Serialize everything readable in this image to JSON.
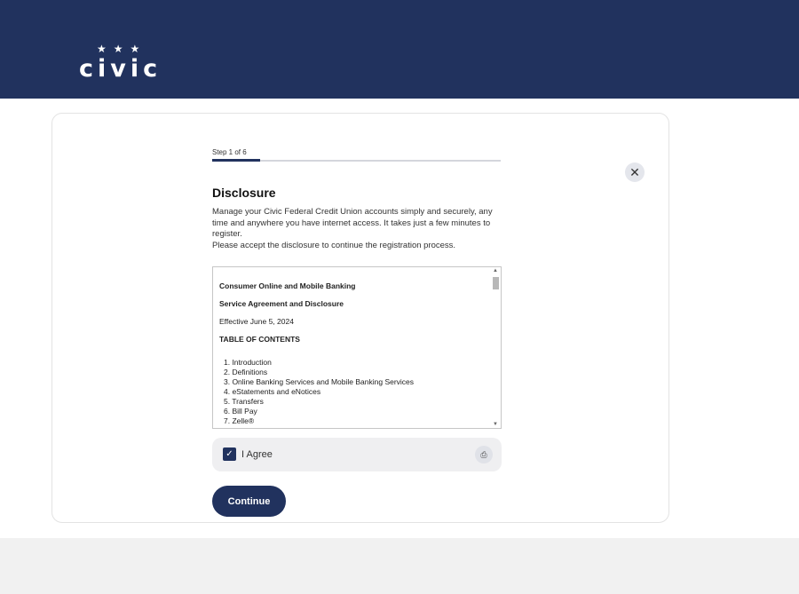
{
  "header": {
    "logo_text": "civic",
    "logo_stars": "★★★"
  },
  "wizard": {
    "step_label": "Step 1 of 6",
    "progress": 0.1667,
    "title": "Disclosure",
    "description": [
      "Manage your Civic Federal Credit Union accounts simply and securely, any time and anywhere you have internet access. It takes just a few minutes to register.",
      "Please accept the disclosure to continue the registration process."
    ],
    "close_label": "✕"
  },
  "disclosure": {
    "heading": "Consumer Online and Mobile Banking",
    "subheading": "Service Agreement and Disclosure",
    "effective": "Effective June 5, 2024",
    "toc_heading": "TABLE OF CONTENTS",
    "toc_items": [
      "1. Introduction",
      "2. Definitions",
      "3. Online Banking Services and Mobile Banking Services",
      "4. eStatements and eNotices",
      "5. Transfers",
      "6. Bill Pay",
      "7. Zelle®"
    ]
  },
  "agree": {
    "label": "I Agree",
    "checked": true,
    "check_glyph": "✓",
    "print_glyph": "⎙"
  },
  "continue_label": "Continue",
  "colors": {
    "brand": "#21325e",
    "header_bg": "#21325e",
    "page_bg": "#f1f1f1"
  }
}
